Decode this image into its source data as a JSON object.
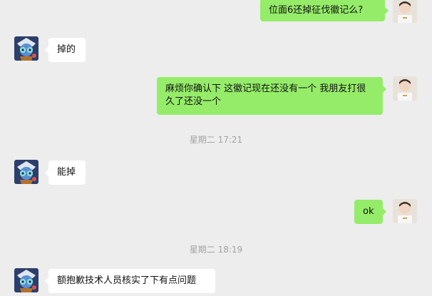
{
  "chat": {
    "messages": [
      {
        "sender": "self",
        "text": "位面6还掉征伐徽记么?"
      },
      {
        "sender": "other",
        "text": "掉的"
      },
      {
        "sender": "self",
        "text": "麻烦你确认下  这徽记现在还没有一个 我朋友打很久了还没一个"
      },
      {
        "sender": "timestamp",
        "text": "星期二 17:21"
      },
      {
        "sender": "other",
        "text": "能掉"
      },
      {
        "sender": "self",
        "text": "ok"
      },
      {
        "sender": "timestamp",
        "text": "星期二 18:19"
      },
      {
        "sender": "other",
        "text": "额抱歉技术人员核实了下有点问题"
      }
    ]
  },
  "avatars": {
    "other": "cartoon-character-avatar",
    "self": "person-photo-avatar"
  },
  "colors": {
    "background": "#ededed",
    "incoming_bubble": "#ffffff",
    "outgoing_bubble": "#95ec69",
    "timestamp_text": "#a3a3a3"
  }
}
